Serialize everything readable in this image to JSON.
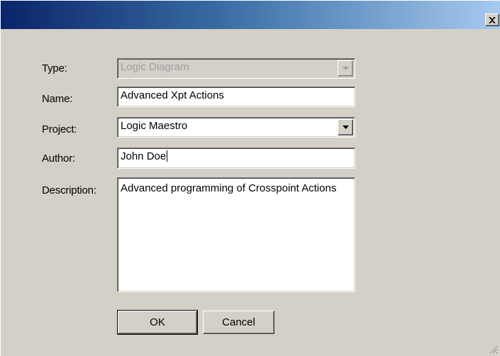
{
  "window": {
    "title": "",
    "close_glyph": "✕"
  },
  "form": {
    "type_label": "Type:",
    "type_value": "Logic Diagram",
    "name_label": "Name:",
    "name_value": "Advanced Xpt Actions",
    "project_label": "Project:",
    "project_value": "Logic Maestro",
    "author_label": "Author:",
    "author_value": "John Doe",
    "description_label": "Description:",
    "description_value": "Advanced programming of Crosspoint Actions"
  },
  "buttons": {
    "ok_label": "OK",
    "cancel_label": "Cancel"
  },
  "colors": {
    "title_start": "#0a246a",
    "title_end": "#a6caf0",
    "face": "#d4d0c8"
  }
}
